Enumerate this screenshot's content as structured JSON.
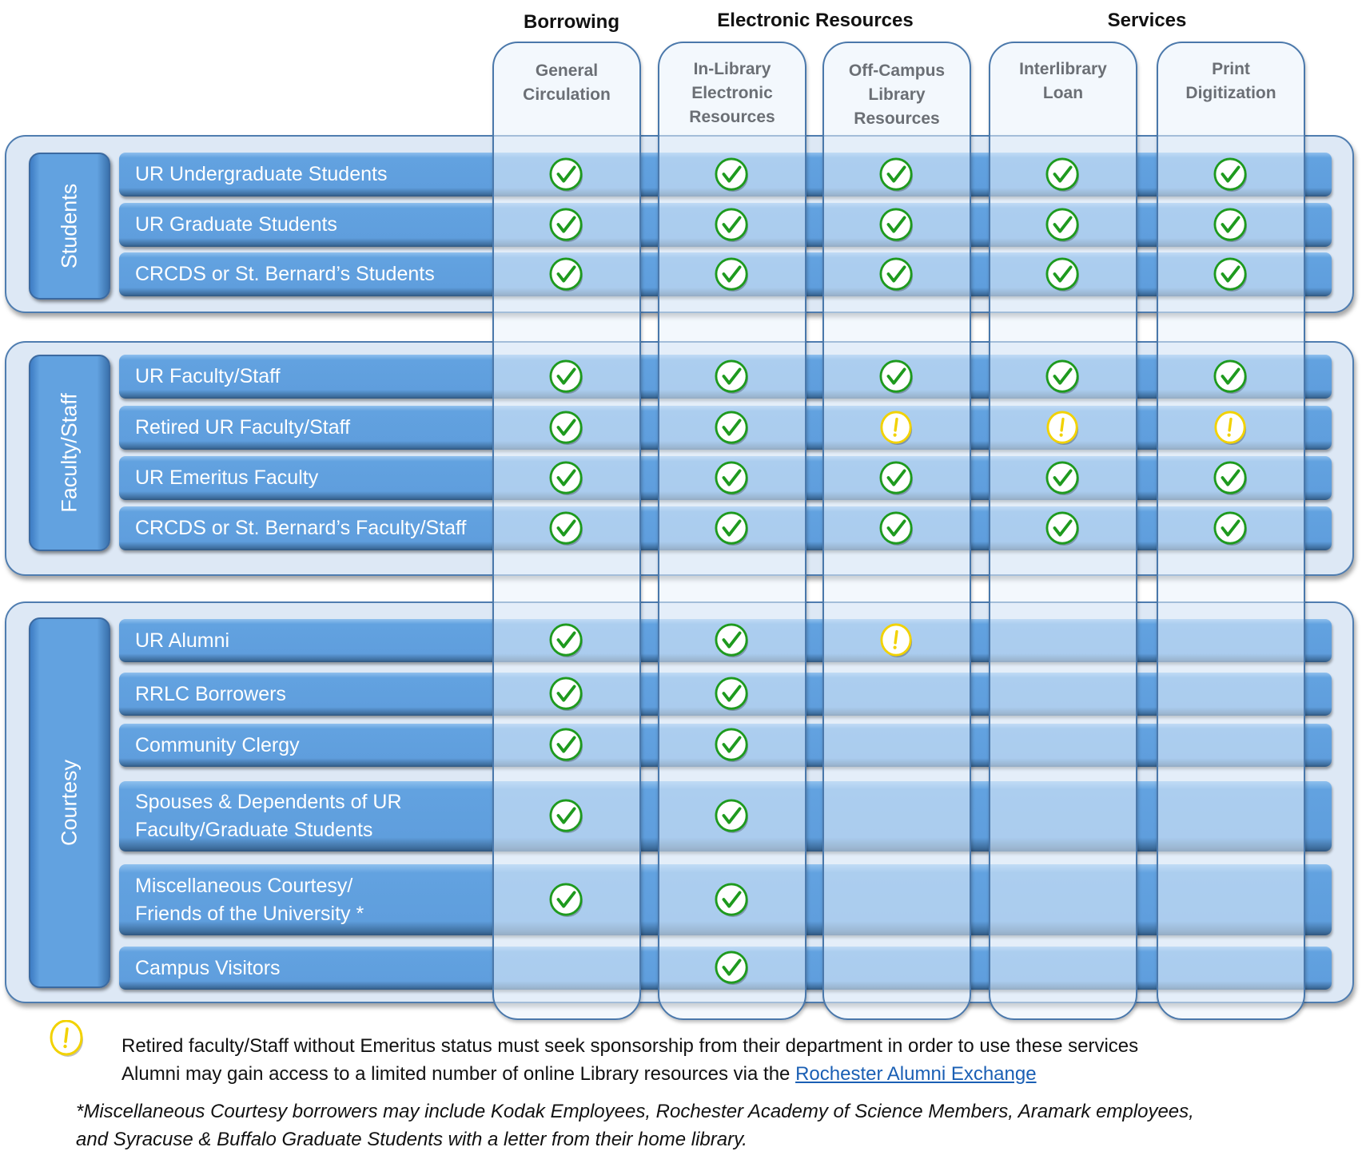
{
  "categories": [
    {
      "label": "Borrowing"
    },
    {
      "label": "Electronic Resources"
    },
    {
      "label": "Services"
    }
  ],
  "columns": [
    {
      "label_lines": [
        "General",
        "Circulation"
      ]
    },
    {
      "label_lines": [
        "In-Library",
        "Electronic",
        "Resources"
      ]
    },
    {
      "label_lines": [
        "Off-Campus",
        "Library",
        "Resources"
      ]
    },
    {
      "label_lines": [
        "Interlibrary",
        "Loan"
      ]
    },
    {
      "label_lines": [
        "Print",
        "Digitization"
      ]
    }
  ],
  "groups": [
    {
      "label": "Students"
    },
    {
      "label": "Faculty/Staff"
    },
    {
      "label": "Courtesy"
    }
  ],
  "rows": [
    {
      "group": "Students",
      "lines": [
        "UR Undergraduate Students"
      ],
      "access": [
        "check",
        "check",
        "check",
        "check",
        "check"
      ]
    },
    {
      "group": "Students",
      "lines": [
        "UR Graduate Students"
      ],
      "access": [
        "check",
        "check",
        "check",
        "check",
        "check"
      ]
    },
    {
      "group": "Students",
      "lines": [
        "CRCDS or St. Bernard’s Students"
      ],
      "access": [
        "check",
        "check",
        "check",
        "check",
        "check"
      ]
    },
    {
      "group": "Faculty/Staff",
      "lines": [
        "UR Faculty/Staff"
      ],
      "access": [
        "check",
        "check",
        "check",
        "check",
        "check"
      ]
    },
    {
      "group": "Faculty/Staff",
      "lines": [
        "Retired UR Faculty/Staff"
      ],
      "access": [
        "check",
        "check",
        "caution",
        "caution",
        "caution"
      ]
    },
    {
      "group": "Faculty/Staff",
      "lines": [
        "UR Emeritus Faculty"
      ],
      "access": [
        "check",
        "check",
        "check",
        "check",
        "check"
      ]
    },
    {
      "group": "Faculty/Staff",
      "lines": [
        "CRCDS or St. Bernard’s Faculty/Staff"
      ],
      "access": [
        "check",
        "check",
        "check",
        "check",
        "check"
      ]
    },
    {
      "group": "Courtesy",
      "lines": [
        "UR Alumni"
      ],
      "access": [
        "check",
        "check",
        "caution",
        "none",
        "none"
      ]
    },
    {
      "group": "Courtesy",
      "lines": [
        "RRLC Borrowers"
      ],
      "access": [
        "check",
        "check",
        "none",
        "none",
        "none"
      ]
    },
    {
      "group": "Courtesy",
      "lines": [
        "Community Clergy"
      ],
      "access": [
        "check",
        "check",
        "none",
        "none",
        "none"
      ]
    },
    {
      "group": "Courtesy",
      "lines": [
        "Spouses & Dependents of UR",
        "Faculty/Graduate Students"
      ],
      "access": [
        "check",
        "check",
        "none",
        "none",
        "none"
      ]
    },
    {
      "group": "Courtesy",
      "lines": [
        "Miscellaneous Courtesy/",
        "Friends of the University *"
      ],
      "access": [
        "check",
        "check",
        "none",
        "none",
        "none"
      ]
    },
    {
      "group": "Courtesy",
      "lines": [
        "Campus Visitors"
      ],
      "access": [
        "none",
        "check",
        "none",
        "none",
        "none"
      ]
    }
  ],
  "icons": {
    "check": "check-circle-icon",
    "caution": "caution-exclamation-icon"
  },
  "colors": {
    "check": "#1e9a1e",
    "caution": "#f2d200",
    "bar": "#62a2e0",
    "group_bg": "#dde8f5",
    "border": "#4a78ab"
  },
  "legend": {
    "line1": "Retired faculty/Staff without Emeritus status must seek sponsorship from their department in order to use these services",
    "line2_prefix": "Alumni may gain access to a limited number of online Library resources via the ",
    "line2_link": "Rochester Alumni Exchange"
  },
  "footnote": {
    "line1": "*Miscellaneous Courtesy borrowers may include Kodak Employees, Rochester Academy of Science Members, Aramark employees,",
    "line2": "and Syracuse & Buffalo Graduate Students with a letter from their home library."
  }
}
